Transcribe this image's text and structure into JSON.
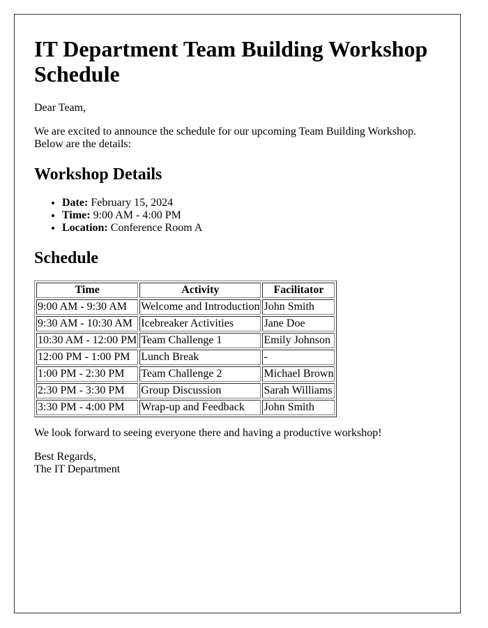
{
  "title": "IT Department Team Building Workshop Schedule",
  "greeting": "Dear Team,",
  "intro": "We are excited to announce the schedule for our upcoming Team Building Workshop. Below are the details:",
  "details": {
    "heading": "Workshop Details",
    "items": [
      {
        "label": "Date:",
        "value": " February 15, 2024"
      },
      {
        "label": "Time:",
        "value": " 9:00 AM - 4:00 PM"
      },
      {
        "label": "Location:",
        "value": " Conference Room A"
      }
    ]
  },
  "schedule": {
    "heading": "Schedule",
    "columns": [
      "Time",
      "Activity",
      "Facilitator"
    ],
    "rows": [
      [
        "9:00 AM - 9:30 AM",
        "Welcome and Introduction",
        "John Smith"
      ],
      [
        "9:30 AM - 10:30 AM",
        "Icebreaker Activities",
        "Jane Doe"
      ],
      [
        "10:30 AM - 12:00 PM",
        "Team Challenge 1",
        "Emily Johnson"
      ],
      [
        "12:00 PM - 1:00 PM",
        "Lunch Break",
        "-"
      ],
      [
        "1:00 PM - 2:30 PM",
        "Team Challenge 2",
        "Michael Brown"
      ],
      [
        "2:30 PM - 3:30 PM",
        "Group Discussion",
        "Sarah Williams"
      ],
      [
        "3:30 PM - 4:00 PM",
        "Wrap-up and Feedback",
        "John Smith"
      ]
    ]
  },
  "closing": "We look forward to seeing everyone there and having a productive workshop!",
  "signoff": {
    "line1": "Best Regards,",
    "line2": "The IT Department"
  }
}
